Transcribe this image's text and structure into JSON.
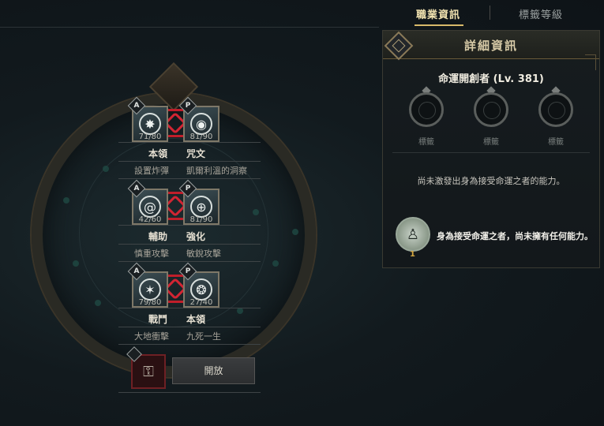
{
  "tabs": {
    "active": "職業資訊",
    "inactive": "標籤等級"
  },
  "skill_rows": [
    {
      "left": {
        "badge": "A",
        "count": "71/80",
        "category": "本領",
        "name": "設置炸彈",
        "icon": "starburst-icon"
      },
      "right": {
        "badge": "P",
        "count": "81/90",
        "category": "咒文",
        "name": "凱爾利溫的洞察",
        "icon": "eye-rune-icon"
      }
    },
    {
      "left": {
        "badge": "A",
        "count": "42/60",
        "category": "輔助",
        "name": "慎重攻擊",
        "icon": "swirl-icon"
      },
      "right": {
        "badge": "P",
        "count": "81/90",
        "category": "強化",
        "name": "敏銳攻擊",
        "icon": "crosshair-icon"
      }
    },
    {
      "left": {
        "badge": "A",
        "count": "79/80",
        "category": "戰鬥",
        "name": "大地衝擊",
        "icon": "impact-icon"
      },
      "right": {
        "badge": "P",
        "count": "27/40",
        "category": "本領",
        "name": "九死一生",
        "icon": "shell-icon"
      }
    }
  ],
  "lock_slot": {
    "icon": "padlock-icon"
  },
  "open_button": "開放",
  "detail": {
    "title": "詳細資訊",
    "class_name": "命運開創者 (Lv. 381)",
    "tags": [
      "標籤",
      "標籤",
      "標籤"
    ],
    "message_1": "尚未激發出身為接受命運之者的能力。",
    "fate_icon": "hooded-figure-icon",
    "fate_level": "1",
    "message_2": "身為接受命運之者，尚未擁有任何能力。"
  },
  "colors": {
    "accent_gold": "#d8b96a",
    "link_red": "#c01e2a",
    "panel_bg": "#161c1f"
  }
}
